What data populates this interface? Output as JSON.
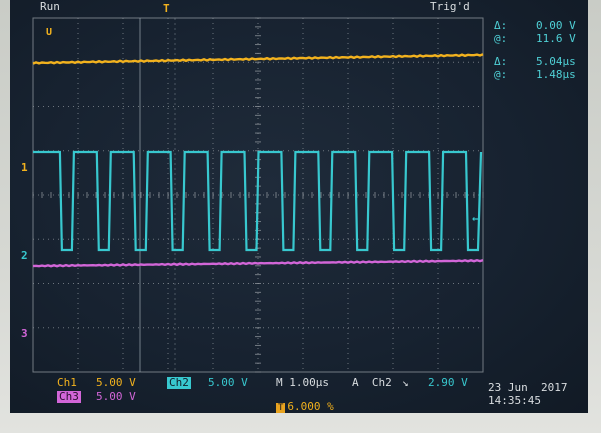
{
  "top": {
    "left_label": "Run",
    "trigger_label": "Trig'd"
  },
  "markers": {
    "trigger_position": "T",
    "cursor_marker": "U",
    "ch1": "1",
    "ch2": "2",
    "ch3": "3",
    "trigger_level_arrow": "←"
  },
  "cursor_readout": {
    "amp_delta_label": "Δ:",
    "amp_delta_value": "0.00 V",
    "amp_at_label": "@:",
    "amp_at_value": "11.6 V",
    "time_delta_label": "Δ:",
    "time_delta_value": "5.04µs",
    "time_at_label": "@:",
    "time_at_value": "1.48µs"
  },
  "status": {
    "ch1_label": "Ch1",
    "ch1_scale": "5.00 V",
    "ch2_label": "Ch2",
    "ch2_scale": "5.00 V",
    "timebase": "M 1.00µs",
    "trigger": "A  Ch2",
    "trigger_slope": "↘",
    "trigger_level": "2.90 V",
    "ch3_label": "Ch3",
    "ch3_scale": "5.00 V",
    "trigger_position": "6.000 %",
    "date": "23 Jun  2017",
    "time": "14:35:45"
  },
  "colors": {
    "ch1": "#f2b21e",
    "ch2": "#38c8cf",
    "ch3": "#d266d8",
    "grid": "#8a9198"
  },
  "waveforms": {
    "ch2_pulse_count": 12,
    "ch2_high_fraction": 0.62
  }
}
